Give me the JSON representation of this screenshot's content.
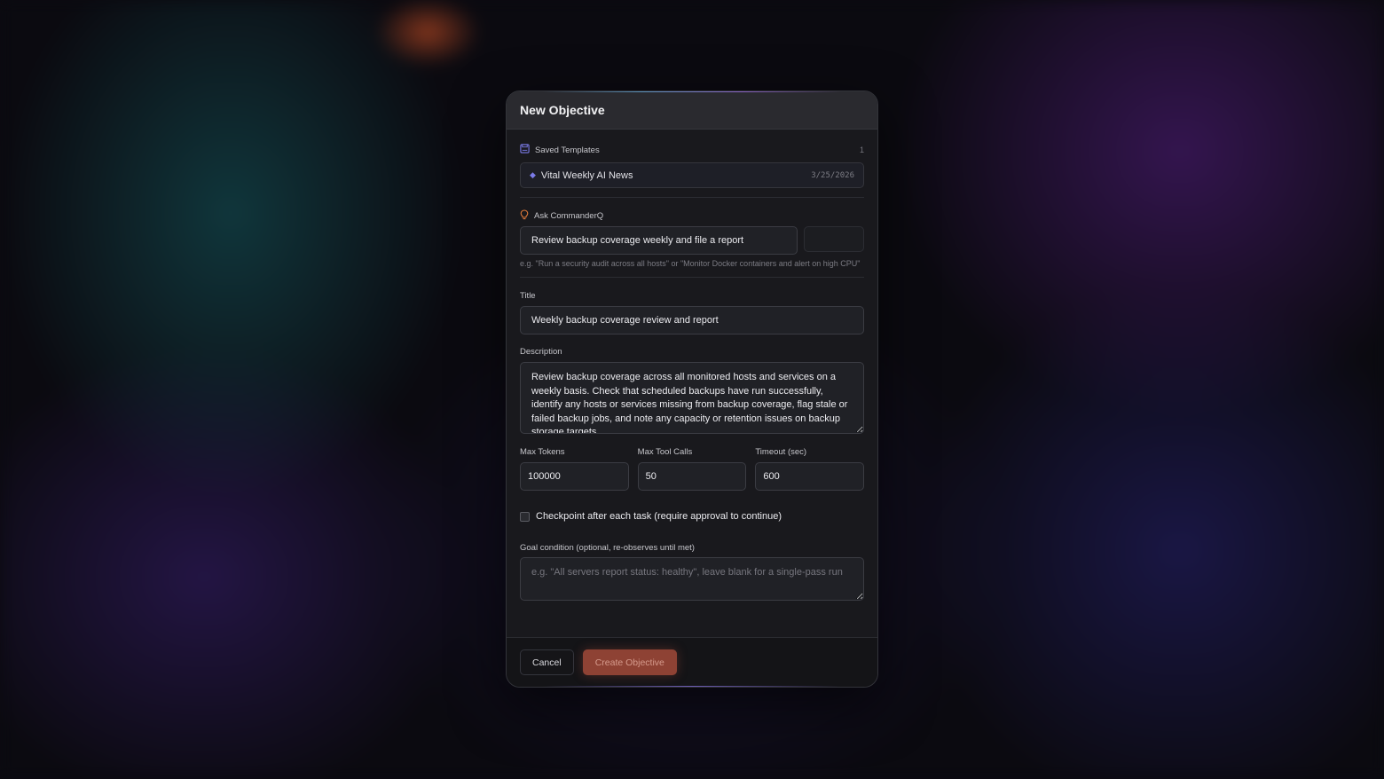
{
  "modal": {
    "title": "New Objective"
  },
  "templates": {
    "label": "Saved Templates",
    "count": "1",
    "items": [
      {
        "name": "Vital Weekly AI News",
        "date": "3/25/2026"
      }
    ]
  },
  "ask": {
    "label": "Ask CommanderQ",
    "value": "Review backup coverage weekly and file a report",
    "hint": "e.g. \"Run a security audit across all hosts\" or \"Monitor Docker containers and alert on high CPU\""
  },
  "title_field": {
    "label": "Title",
    "value": "Weekly backup coverage review and report"
  },
  "description_field": {
    "label": "Description",
    "value": "Review backup coverage across all monitored hosts and services on a weekly basis. Check that scheduled backups have run successfully, identify any hosts or services missing from backup coverage, flag stale or failed backup jobs, and note any capacity or retention issues on backup storage targets."
  },
  "limits": {
    "max_tokens_label": "Max Tokens",
    "max_tokens": "100000",
    "max_tool_calls_label": "Max Tool Calls",
    "max_tool_calls": "50",
    "timeout_label": "Timeout (sec)",
    "timeout": "600"
  },
  "checkpoint": {
    "label": "Checkpoint after each task (require approval to continue)",
    "checked": false
  },
  "goal": {
    "label": "Goal condition (optional, re-observes until met)",
    "placeholder": "e.g. \"All servers report status: healthy\", leave blank for a single-pass run"
  },
  "footer": {
    "cancel_label": "Cancel",
    "create_label": "Create Objective"
  },
  "colors": {
    "accent_button": "#8e4234",
    "template_diamond": "#7b7be8",
    "bulb_icon": "#e07a3a",
    "save_icon": "#7b7be8"
  },
  "icons": {
    "templates": "save-icon",
    "ask": "lightbulb-icon",
    "template_item": "diamond-icon"
  }
}
